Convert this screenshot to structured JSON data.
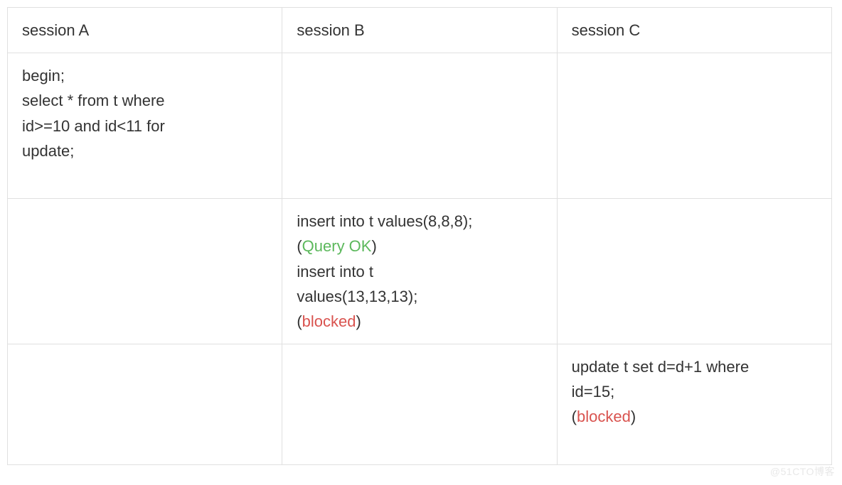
{
  "headers": {
    "a": "session A",
    "b": "session B",
    "c": "session C"
  },
  "row1": {
    "a": {
      "l1": "begin;",
      "l2": "select * from t where",
      "l3": "id>=10 and id<11 for",
      "l4": "update;"
    }
  },
  "row2": {
    "b": {
      "l1": "insert into t values(8,8,8);",
      "l2_open": "(",
      "l2_status": "Query OK",
      "l2_close": ")",
      "l3": "insert into t",
      "l4": "values(13,13,13);",
      "l5_open": "(",
      "l5_status": "blocked",
      "l5_close": ")"
    }
  },
  "row3": {
    "c": {
      "l1": "update t set d=d+1 where",
      "l2": "id=15;",
      "l3_open": "(",
      "l3_status": "blocked",
      "l3_close": ")"
    }
  },
  "watermark": "@51CTO博客"
}
